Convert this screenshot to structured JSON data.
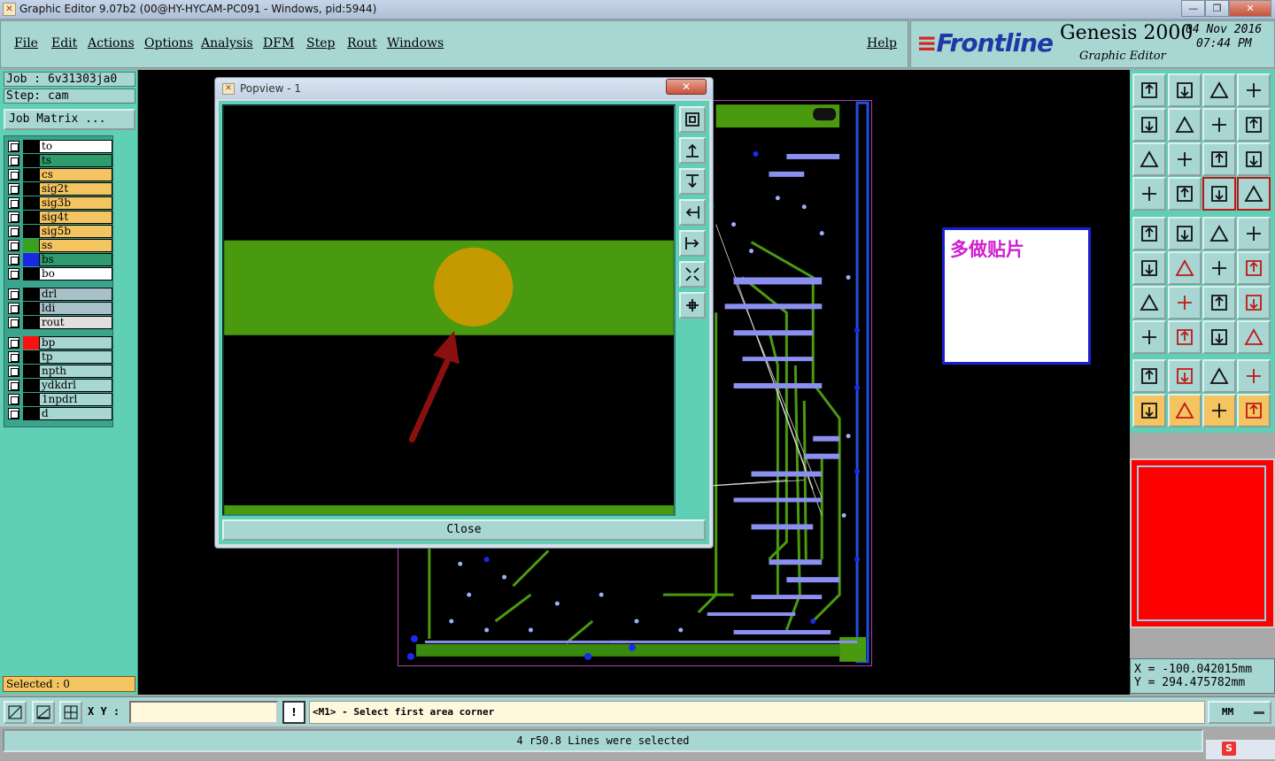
{
  "window": {
    "title": "Graphic Editor 9.07b2 (00@HY-HYCAM-PC091 - Windows, pid:5944)",
    "app_icon": "graphic-editor-icon",
    "buttons": {
      "minimize": "—",
      "maximize": "❐",
      "close": "✕"
    }
  },
  "menu": {
    "file": "File",
    "edit": "Edit",
    "actions": "Actions",
    "options": "Options",
    "analysis": "Analysis",
    "dfm": "DFM",
    "step": "Step",
    "rout": "Rout",
    "windows": "Windows",
    "help": "Help"
  },
  "brand": {
    "logo_prefix": "≡",
    "logo": "Frontline",
    "product": "Genesis 2000",
    "subtitle": "Graphic Editor",
    "date": "04 Nov 2016",
    "time": "07:44 PM"
  },
  "left": {
    "job": "Job : 6v31303ja0",
    "step": "Step: cam",
    "job_matrix": "Job Matrix ...",
    "selected": "Selected : 0"
  },
  "layers": [
    {
      "name": "to",
      "color": "#ffffff",
      "swatch": "#000000"
    },
    {
      "name": "ts",
      "color": "#2e9c6c",
      "swatch": "#000000"
    },
    {
      "name": "cs",
      "color": "#f4c460",
      "swatch": "#000000"
    },
    {
      "name": "sig2t",
      "color": "#f4c460",
      "swatch": "#000000"
    },
    {
      "name": "sig3b",
      "color": "#f4c460",
      "swatch": "#000000"
    },
    {
      "name": "sig4t",
      "color": "#f4c460",
      "swatch": "#000000"
    },
    {
      "name": "sig5b",
      "color": "#f4c460",
      "swatch": "#000000"
    },
    {
      "name": "ss",
      "color": "#f4c460",
      "swatch": "#3aa020"
    },
    {
      "name": "bs",
      "color": "#2e9c6c",
      "swatch": "#1a28e0"
    },
    {
      "name": "bo",
      "color": "#ffffff",
      "swatch": "#000000"
    },
    {
      "name": "drl",
      "color": "#a8c0c8",
      "swatch": "#000000"
    },
    {
      "name": "ldi",
      "color": "#a8c0c8",
      "swatch": "#000000"
    },
    {
      "name": "rout",
      "color": "#e0e0e0",
      "swatch": "#000000"
    },
    {
      "name": "bp",
      "color": "#a8d6d3",
      "swatch": "#ff1010"
    },
    {
      "name": "tp",
      "color": "#a8d6d3",
      "swatch": "#000000"
    },
    {
      "name": "npth",
      "color": "#a8d6d3",
      "swatch": "#000000"
    },
    {
      "name": "ydkdrl",
      "color": "#a8d6d3",
      "swatch": "#000000"
    },
    {
      "name": "1npdrl",
      "color": "#a8d6d3",
      "swatch": "#000000"
    },
    {
      "name": "d",
      "color": "#a8d6d3",
      "swatch": "#000000"
    }
  ],
  "note": {
    "text": "多做贴片"
  },
  "popview": {
    "title": "Popview - 1",
    "close_x": "✕",
    "close_label": "Close"
  },
  "coords": {
    "x": "X = -100.042015mm",
    "y": "Y = 294.475782mm"
  },
  "command": {
    "xy_label": "X Y :",
    "xy_value": "",
    "alert": "!",
    "prompt": "<M1> - Select first area corner",
    "units": "MM"
  },
  "status": {
    "message": "4 r50.8 Lines were selected"
  },
  "colors": {
    "panel": "#5fcfb6",
    "control": "#a8d6d3",
    "highlight": "#f4c460",
    "copper_green": "#4a9a10",
    "pad_gold": "#c49a00",
    "arrow": "#8a1010"
  }
}
